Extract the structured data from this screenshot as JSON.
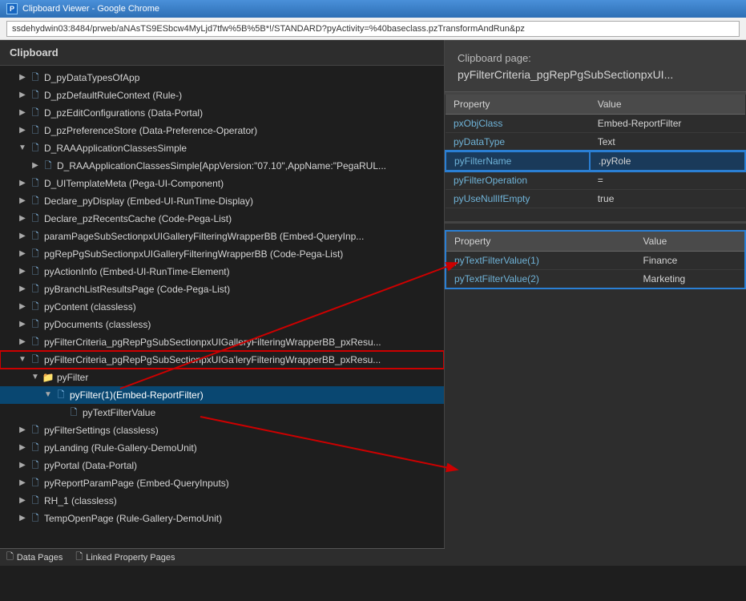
{
  "titlebar": {
    "favicon_label": "P",
    "title": "Clipboard Viewer - Google Chrome"
  },
  "address": {
    "url": "ssdehydwin03:8484/prweb/aNAsTS9ESbcw4MyLjd7tfw%5B%5B*!/STANDARD?pyActivity=%40baseclass.pzTransformAndRun&pz"
  },
  "left_panel": {
    "header": "Clipboard"
  },
  "tree": {
    "items": [
      {
        "id": "D_pyDataTypesOfApp",
        "label": "D_pyDataTypesOfApp",
        "indent": 1,
        "type": "page",
        "expanded": false,
        "selected": false
      },
      {
        "id": "D_pzDefaultRuleContext",
        "label": "D_pzDefaultRuleContext (Rule-)",
        "indent": 1,
        "type": "page",
        "expanded": false,
        "selected": false
      },
      {
        "id": "D_pzEditConfigurations",
        "label": "D_pzEditConfigurations (Data-Portal)",
        "indent": 1,
        "type": "page",
        "expanded": false,
        "selected": false
      },
      {
        "id": "D_pzPreferenceStore",
        "label": "D_pzPreferenceStore (Data-Preference-Operator)",
        "indent": 1,
        "type": "page",
        "expanded": false,
        "selected": false
      },
      {
        "id": "D_RAAApplicationClassesSimple",
        "label": "D_RAAApplicationClassesSimple",
        "indent": 1,
        "type": "page",
        "expanded": true,
        "selected": false
      },
      {
        "id": "D_RAAApplicationClassesSimple_child",
        "label": "D_RAAApplicationClassesSimple[AppVersion:\"07.10\",AppName:\"PegaRUL...",
        "indent": 2,
        "type": "page",
        "expanded": false,
        "selected": false
      },
      {
        "id": "D_UITemplateMeta",
        "label": "D_UITemplateMeta (Pega-UI-Component)",
        "indent": 1,
        "type": "page",
        "expanded": false,
        "selected": false
      },
      {
        "id": "Declare_pyDisplay",
        "label": "Declare_pyDisplay (Embed-UI-RunTime-Display)",
        "indent": 1,
        "type": "page",
        "expanded": false,
        "selected": false
      },
      {
        "id": "Declare_pzRecentsCache",
        "label": "Declare_pzRecentsCache (Code-Pega-List)",
        "indent": 1,
        "type": "page",
        "expanded": false,
        "selected": false
      },
      {
        "id": "paramPageSubSection",
        "label": "paramPageSubSectionpxUIGalleryFilteringWrapperBB (Embed-QueryInp...",
        "indent": 1,
        "type": "page",
        "expanded": false,
        "selected": false
      },
      {
        "id": "pgRepPgSubSection1",
        "label": "pgRepPgSubSectionpxUIGalleryFilteringWrapperBB (Code-Pega-List)",
        "indent": 1,
        "type": "page",
        "expanded": false,
        "selected": false
      },
      {
        "id": "pyActionInfo",
        "label": "pyActionInfo (Embed-UI-RunTime-Element)",
        "indent": 1,
        "type": "page",
        "expanded": false,
        "selected": false
      },
      {
        "id": "pyBranchListResultsPage",
        "label": "pyBranchListResultsPage (Code-Pega-List)",
        "indent": 1,
        "type": "page",
        "expanded": false,
        "selected": false
      },
      {
        "id": "pyContent",
        "label": "pyContent (classless)",
        "indent": 1,
        "type": "page",
        "expanded": false,
        "selected": false
      },
      {
        "id": "pyDocuments",
        "label": "pyDocuments (classless)",
        "indent": 1,
        "type": "page",
        "expanded": false,
        "selected": false
      },
      {
        "id": "pyFilterCriteria1",
        "label": "pyFilterCriteria_pgRepPgSubSectionpxUIGalleryFilteringWrapperBB_pxResu...",
        "indent": 1,
        "type": "page",
        "expanded": false,
        "selected": false
      },
      {
        "id": "pyFilterCriteria2",
        "label": "pyFilterCriteria_pgRepPgSubSectionpxUIGa'leryFilteringWrapperBB_pxResu...",
        "indent": 1,
        "type": "page",
        "expanded": true,
        "selected": false,
        "red_outline": true
      },
      {
        "id": "pyFilter_folder",
        "label": "pyFilter",
        "indent": 2,
        "type": "folder",
        "expanded": true,
        "selected": false
      },
      {
        "id": "pyFilter1",
        "label": "pyFilter(1)(Embed-ReportFilter)",
        "indent": 3,
        "type": "page",
        "expanded": true,
        "selected": true
      },
      {
        "id": "pyTextFilterValue",
        "label": "pyTextFilterValue",
        "indent": 4,
        "type": "page",
        "expanded": false,
        "selected": false
      },
      {
        "id": "pyFilterSettings",
        "label": "pyFilterSettings (classless)",
        "indent": 1,
        "type": "page",
        "expanded": false,
        "selected": false
      },
      {
        "id": "pyLanding",
        "label": "pyLanding (Rule-Gallery-DemoUnit)",
        "indent": 1,
        "type": "page",
        "expanded": false,
        "selected": false
      },
      {
        "id": "pyPortal",
        "label": "pyPortal (Data-Portal)",
        "indent": 1,
        "type": "page",
        "expanded": false,
        "selected": false
      },
      {
        "id": "pyReportParamPage",
        "label": "pyReportParamPage (Embed-QueryInputs)",
        "indent": 1,
        "type": "page",
        "expanded": false,
        "selected": false
      },
      {
        "id": "RH_1",
        "label": "RH_1 (classless)",
        "indent": 1,
        "type": "page",
        "expanded": false,
        "selected": false
      },
      {
        "id": "TempOpenPage",
        "label": "TempOpenPage (Rule-Gallery-DemoUnit)",
        "indent": 1,
        "type": "page",
        "expanded": false,
        "selected": false
      }
    ]
  },
  "bottom_items": [
    {
      "id": "data-pages",
      "label": "Data Pages"
    },
    {
      "id": "linked-property-pages",
      "label": "Linked Property Pages"
    }
  ],
  "right_panel": {
    "clipboard_title": "Clipboard page:\npyFilterCriteria_pgRepPgSubSectionpxUI...",
    "table1": {
      "headers": [
        "Property",
        "Value"
      ],
      "rows": [
        {
          "prop": "pxObjClass",
          "value": "Embed-ReportFilter",
          "highlighted": false
        },
        {
          "prop": "pyDataType",
          "value": "Text",
          "highlighted": false
        },
        {
          "prop": "pyFilterName",
          "value": ".pyRole",
          "highlighted": true
        },
        {
          "prop": "pyFilterOperation",
          "value": "=",
          "highlighted": false
        },
        {
          "prop": "pyUseNullIfEmpty",
          "value": "true",
          "highlighted": false
        }
      ]
    },
    "table2": {
      "headers": [
        "Property",
        "Value"
      ],
      "rows": [
        {
          "prop": "pyTextFilterValue(1)",
          "value": "Finance",
          "highlighted": false
        },
        {
          "prop": "pyTextFilterValue(2)",
          "value": "Marketing",
          "highlighted": false
        }
      ]
    }
  }
}
